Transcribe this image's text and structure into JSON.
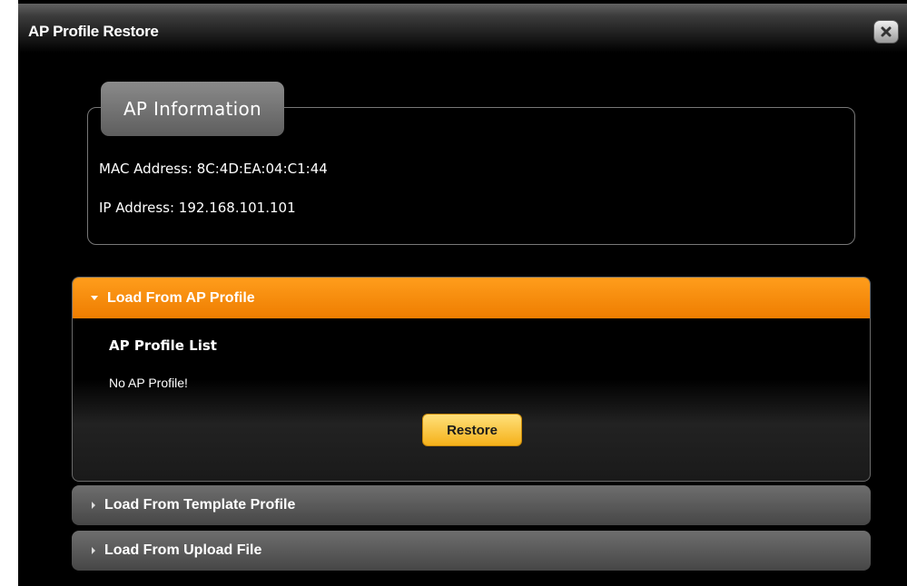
{
  "dialog": {
    "title": "AP Profile Restore",
    "close_icon": "close-icon"
  },
  "ap_info": {
    "legend": "AP Information",
    "mac_line": "MAC Address: 8C:4D:EA:04:C1:44",
    "ip_line": "IP Address: 192.168.101.101"
  },
  "sections": {
    "ap_profile": {
      "label": "Load From AP Profile",
      "expanded": true,
      "list_title": "AP Profile List",
      "empty_message": "No AP Profile!",
      "restore_label": "Restore"
    },
    "template_profile": {
      "label": "Load From Template Profile",
      "expanded": false
    },
    "upload_file": {
      "label": "Load From Upload File",
      "expanded": false
    }
  },
  "colors": {
    "accent_orange": "#f58a0b",
    "button_yellow": "#f8c43a",
    "background": "#000000",
    "collapsed_header": "#555555"
  }
}
